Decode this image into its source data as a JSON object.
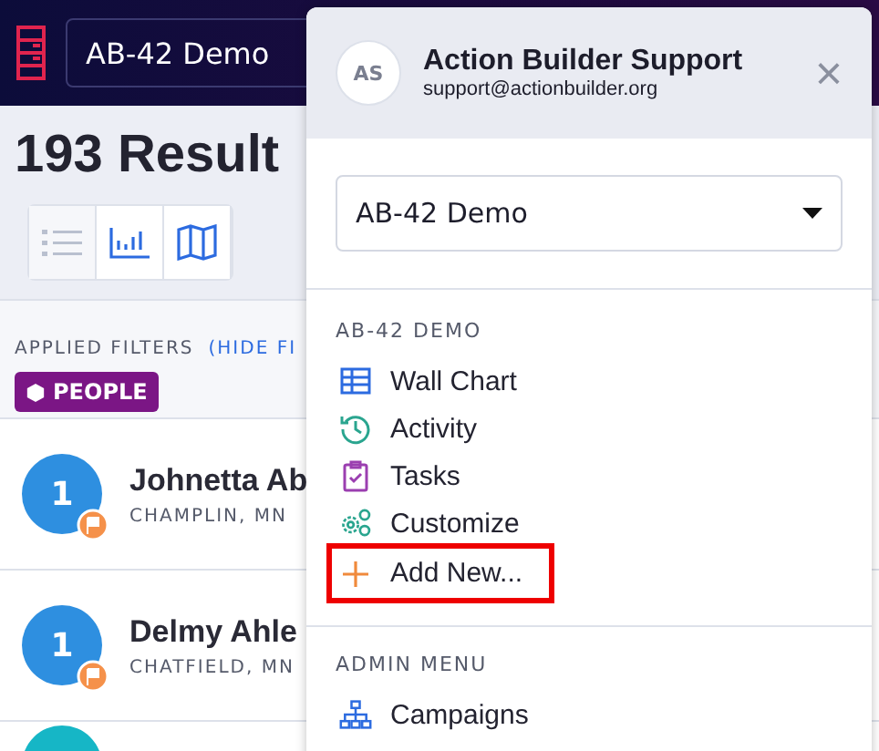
{
  "header": {
    "campaign_select": "AB-42 Demo"
  },
  "results_title": "193 Result",
  "views": [
    {
      "kind": "list",
      "selected": false
    },
    {
      "kind": "chart",
      "selected": true
    },
    {
      "kind": "map",
      "selected": true
    }
  ],
  "filters": {
    "label": "APPLIED FILTERS",
    "toggle": "(HIDE FI",
    "tags": [
      "PEOPLE"
    ]
  },
  "people": [
    {
      "badge": "1",
      "name": "Johnetta Ab",
      "place": "CHAMPLIN, MN",
      "color": "#2e8fe0"
    },
    {
      "badge": "1",
      "name": "Delmy Ahle",
      "place": "CHATFIELD, MN",
      "color": "#2e8fe0"
    },
    {
      "color": "#16b6c6"
    }
  ],
  "menu": {
    "avatar": "AS",
    "name": "Action Builder Support",
    "email": "support@actionbuilder.org",
    "close": "×",
    "campaign_select": "AB-42 Demo",
    "sections": [
      {
        "title": "AB-42 DEMO",
        "items": [
          {
            "kind": "grid",
            "label": "Wall Chart",
            "highlighted": false
          },
          {
            "kind": "history",
            "label": "Activity",
            "highlighted": false
          },
          {
            "kind": "clipboard",
            "label": "Tasks",
            "highlighted": false
          },
          {
            "kind": "gears",
            "label": "Customize",
            "highlighted": false
          },
          {
            "kind": "plus",
            "label": "Add New...",
            "highlighted": true
          }
        ]
      },
      {
        "title": "ADMIN MENU",
        "items": [
          {
            "kind": "tree",
            "label": "Campaigns",
            "highlighted": false
          }
        ]
      }
    ]
  }
}
